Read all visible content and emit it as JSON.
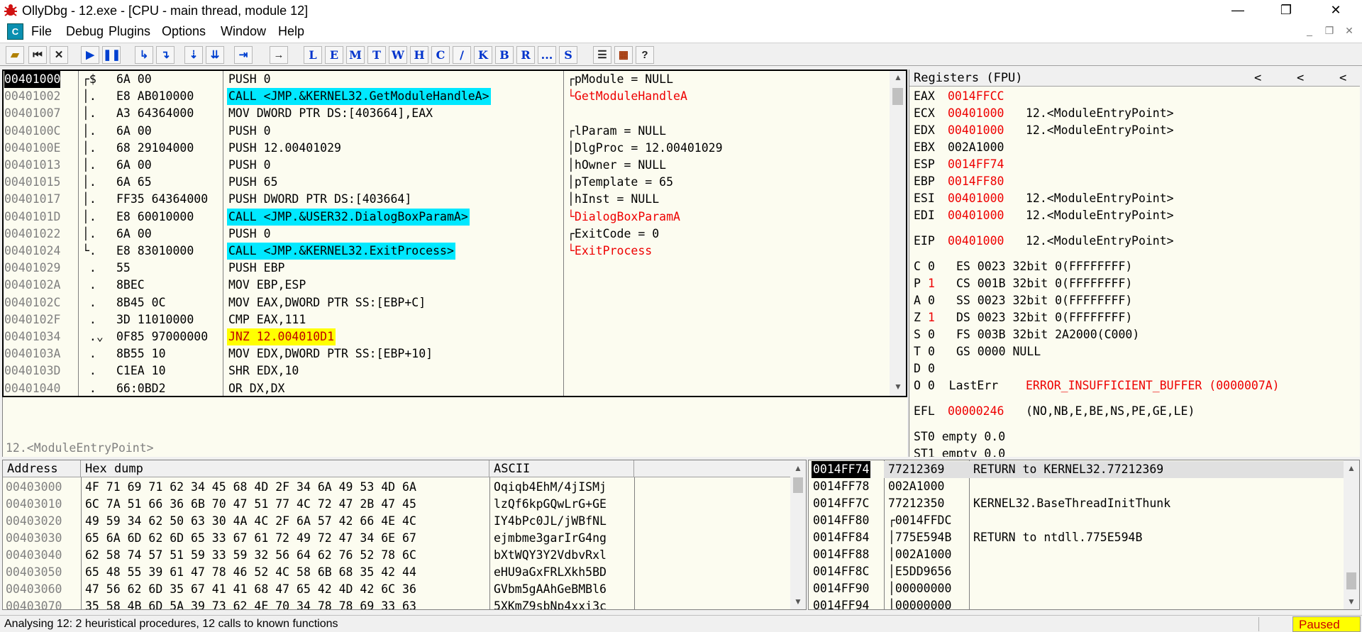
{
  "window": {
    "title": "OllyDbg - 12.exe - [CPU - main thread, module 12]",
    "controls": [
      "—",
      "❐",
      "✕"
    ]
  },
  "menu": [
    "File",
    "Debug",
    "Plugins",
    "Options",
    "Window",
    "Help"
  ],
  "toolbar": {
    "letters": [
      "L",
      "E",
      "M",
      "T",
      "W",
      "H",
      "C",
      "/",
      "K",
      "B",
      "R",
      "...",
      "S"
    ],
    "help": "?"
  },
  "disasm": {
    "rows": [
      {
        "addr": "00401000",
        "mark": "┌$",
        "hex": "6A 00",
        "instr": "PUSH 0",
        "style": "sel"
      },
      {
        "addr": "00401002",
        "mark": "│.",
        "hex": "E8 AB010000",
        "instr": "CALL <JMP.&KERNEL32.GetModuleHandleA>",
        "style": "cyan"
      },
      {
        "addr": "00401007",
        "mark": "│.",
        "hex": "A3 64364000",
        "instr": "MOV DWORD PTR DS:[403664],EAX",
        "style": ""
      },
      {
        "addr": "0040100C",
        "mark": "│.",
        "hex": "6A 00",
        "instr": "PUSH 0",
        "style": ""
      },
      {
        "addr": "0040100E",
        "mark": "│.",
        "hex": "68 29104000",
        "instr": "PUSH 12.00401029",
        "style": ""
      },
      {
        "addr": "00401013",
        "mark": "│.",
        "hex": "6A 00",
        "instr": "PUSH 0",
        "style": ""
      },
      {
        "addr": "00401015",
        "mark": "│.",
        "hex": "6A 65",
        "instr": "PUSH 65",
        "style": ""
      },
      {
        "addr": "00401017",
        "mark": "│.",
        "hex": "FF35 64364000",
        "instr": "PUSH DWORD PTR DS:[403664]",
        "style": ""
      },
      {
        "addr": "0040101D",
        "mark": "│.",
        "hex": "E8 60010000",
        "instr": "CALL <JMP.&USER32.DialogBoxParamA>",
        "style": "cyan"
      },
      {
        "addr": "00401022",
        "mark": "│.",
        "hex": "6A 00",
        "instr": "PUSH 0",
        "style": ""
      },
      {
        "addr": "00401024",
        "mark": "└.",
        "hex": "E8 83010000",
        "instr": "CALL <JMP.&KERNEL32.ExitProcess>",
        "style": "cyan"
      },
      {
        "addr": "00401029",
        "mark": " .",
        "hex": "55",
        "instr": "PUSH EBP",
        "style": ""
      },
      {
        "addr": "0040102A",
        "mark": " .",
        "hex": "8BEC",
        "instr": "MOV EBP,ESP",
        "style": ""
      },
      {
        "addr": "0040102C",
        "mark": " .",
        "hex": "8B45 0C",
        "instr": "MOV EAX,DWORD PTR SS:[EBP+C]",
        "style": ""
      },
      {
        "addr": "0040102F",
        "mark": " .",
        "hex": "3D 11010000",
        "instr": "CMP EAX,111",
        "style": ""
      },
      {
        "addr": "00401034",
        "mark": " .⌄",
        "hex": "0F85 97000000",
        "instr": "JNZ 12.004010D1",
        "style": "yellow"
      },
      {
        "addr": "0040103A",
        "mark": " .",
        "hex": "8B55 10",
        "instr": "MOV EDX,DWORD PTR SS:[EBP+10]",
        "style": ""
      },
      {
        "addr": "0040103D",
        "mark": " .",
        "hex": "C1EA 10",
        "instr": "SHR EDX,10",
        "style": ""
      },
      {
        "addr": "00401040",
        "mark": " .",
        "hex": "66:0BD2",
        "instr": "OR DX,DX",
        "style": ""
      }
    ],
    "comments": [
      {
        "text": "┌pModule = NULL",
        "row": 0,
        "style": ""
      },
      {
        "text": "└GetModuleHandleA",
        "row": 1,
        "style": "red"
      },
      {
        "text": "┌lParam = NULL",
        "row": 3,
        "style": ""
      },
      {
        "text": "│DlgProc = 12.00401029",
        "row": 4,
        "style": ""
      },
      {
        "text": "│hOwner = NULL",
        "row": 5,
        "style": ""
      },
      {
        "text": "│pTemplate = 65",
        "row": 6,
        "style": ""
      },
      {
        "text": "│hInst = NULL",
        "row": 7,
        "style": ""
      },
      {
        "text": "└DialogBoxParamA",
        "row": 8,
        "style": "red"
      },
      {
        "text": "┌ExitCode = 0",
        "row": 9,
        "style": ""
      },
      {
        "text": "└ExitProcess",
        "row": 10,
        "style": "red"
      }
    ],
    "info_line": "12.<ModuleEntryPoint>"
  },
  "registers": {
    "header": "Registers (FPU)",
    "nav": [
      "<",
      "<",
      "<"
    ],
    "regs": [
      {
        "name": "EAX",
        "value": "0014FFCC",
        "info": ""
      },
      {
        "name": "ECX",
        "value": "00401000",
        "info": "12.<ModuleEntryPoint>"
      },
      {
        "name": "EDX",
        "value": "00401000",
        "info": "12.<ModuleEntryPoint>"
      },
      {
        "name": "EBX",
        "value": "002A1000",
        "info": "",
        "gray": true
      },
      {
        "name": "ESP",
        "value": "0014FF74",
        "info": ""
      },
      {
        "name": "EBP",
        "value": "0014FF80",
        "info": ""
      },
      {
        "name": "ESI",
        "value": "00401000",
        "info": "12.<ModuleEntryPoint>"
      },
      {
        "name": "EDI",
        "value": "00401000",
        "info": "12.<ModuleEntryPoint>"
      }
    ],
    "eip": {
      "name": "EIP",
      "value": "00401000",
      "info": "12.<ModuleEntryPoint>"
    },
    "flags": [
      {
        "flag": "C",
        "val": "0",
        "seg": "ES 0023 32bit 0(FFFFFFFF)",
        "red": false
      },
      {
        "flag": "P",
        "val": "1",
        "seg": "CS 001B 32bit 0(FFFFFFFF)",
        "red": true
      },
      {
        "flag": "A",
        "val": "0",
        "seg": "SS 0023 32bit 0(FFFFFFFF)",
        "red": false
      },
      {
        "flag": "Z",
        "val": "1",
        "seg": "DS 0023 32bit 0(FFFFFFFF)",
        "red": true
      },
      {
        "flag": "S",
        "val": "0",
        "seg": "FS 003B 32bit 2A2000(C000)",
        "red": false
      },
      {
        "flag": "T",
        "val": "0",
        "seg": "GS 0000 NULL",
        "red": false
      },
      {
        "flag": "D",
        "val": "0",
        "seg": "",
        "red": false
      }
    ],
    "lasterr": {
      "label": "O 0  LastErr",
      "value": "ERROR_INSUFFICIENT_BUFFER (0000007A)"
    },
    "efl": {
      "name": "EFL",
      "value": "00000246",
      "info": "(NO,NB,E,BE,NS,PE,GE,LE)"
    },
    "st0": "ST0 empty 0.0",
    "st1": "ST1 empty 0.0"
  },
  "dump": {
    "headers": {
      "address": "Address",
      "hex": "Hex dump",
      "ascii": "ASCII"
    },
    "rows": [
      {
        "addr": "00403000",
        "hex": "4F 71 69 71 62 34 45 68 4D 2F 34 6A 49 53 4D 6A",
        "ascii": "Oqiqb4EhM/4jISMj"
      },
      {
        "addr": "00403010",
        "hex": "6C 7A 51 66 36 6B 70 47 51 77 4C 72 47 2B 47 45",
        "ascii": "lzQf6kpGQwLrG+GE"
      },
      {
        "addr": "00403020",
        "hex": "49 59 34 62 50 63 30 4A 4C 2F 6A 57 42 66 4E 4C",
        "ascii": "IY4bPc0JL/jWBfNL"
      },
      {
        "addr": "00403030",
        "hex": "65 6A 6D 62 6D 65 33 67 61 72 49 72 47 34 6E 67",
        "ascii": "ejmbme3garIrG4ng"
      },
      {
        "addr": "00403040",
        "hex": "62 58 74 57 51 59 33 59 32 56 64 62 76 52 78 6C",
        "ascii": "bXtWQY3Y2VdbvRxl"
      },
      {
        "addr": "00403050",
        "hex": "65 48 55 39 61 47 78 46 52 4C 58 6B 68 35 42 44",
        "ascii": "eHU9aGxFRLXkh5BD"
      },
      {
        "addr": "00403060",
        "hex": "47 56 62 6D 35 67 41 41 68 47 65 42 4D 42 6C 36",
        "ascii": "GVbm5gAAhGeBMBl6"
      },
      {
        "addr": "00403070",
        "hex": "35 58 4B 6D 5A 39 73 62 4E 70 34 78 78 69 33 63",
        "ascii": "5XKmZ9sbNp4xxi3c"
      }
    ]
  },
  "stack": {
    "rows": [
      {
        "addr": "0014FF74",
        "value": "77212369",
        "comment": "RETURN to KERNEL32.77212369",
        "sel": true
      },
      {
        "addr": "0014FF78",
        "value": "002A1000",
        "comment": ""
      },
      {
        "addr": "0014FF7C",
        "value": "77212350",
        "comment": "KERNEL32.BaseThreadInitThunk"
      },
      {
        "addr": "0014FF80",
        "value": "┌0014FFDC",
        "comment": ""
      },
      {
        "addr": "0014FF84",
        "value": "│775E594B",
        "comment": "RETURN to ntdll.775E594B"
      },
      {
        "addr": "0014FF88",
        "value": "│002A1000",
        "comment": ""
      },
      {
        "addr": "0014FF8C",
        "value": "│E5DD9656",
        "comment": ""
      },
      {
        "addr": "0014FF90",
        "value": "│00000000",
        "comment": ""
      },
      {
        "addr": "0014FF94",
        "value": "│00000000",
        "comment": ""
      }
    ]
  },
  "status": {
    "text": "Analysing 12: 2 heuristical procedures, 12 calls to known functions",
    "state": "Paused"
  }
}
